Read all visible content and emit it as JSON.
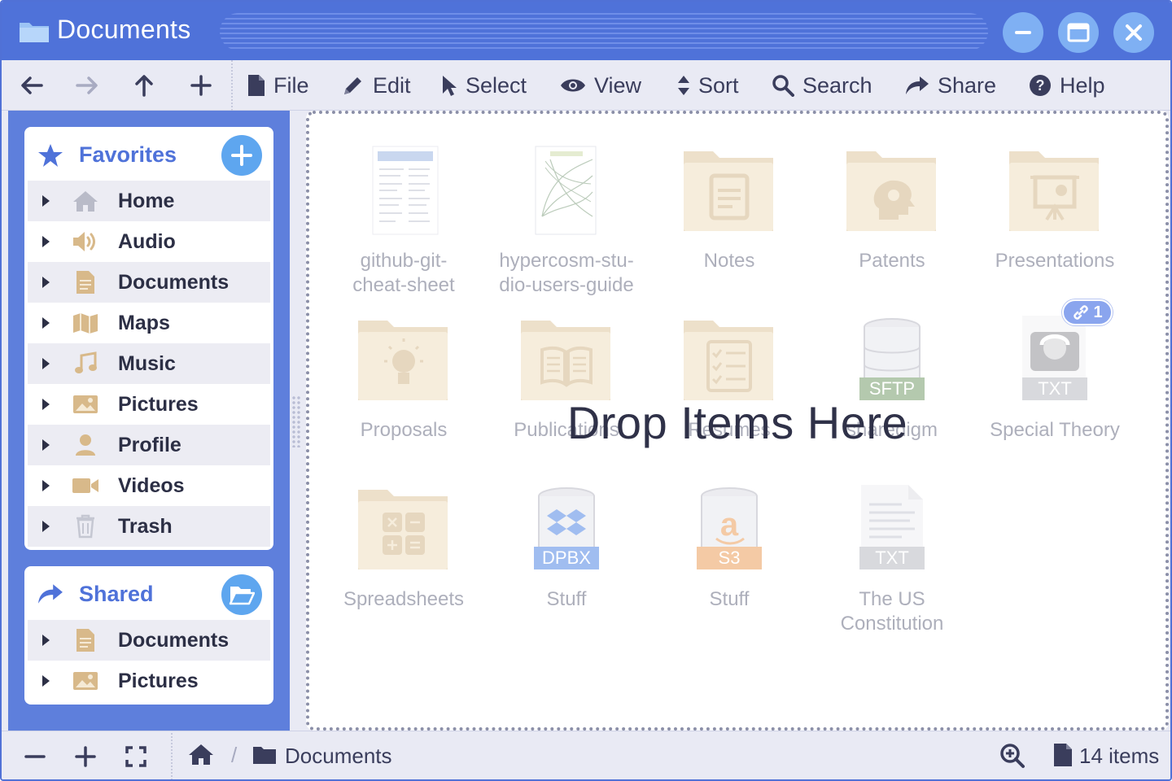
{
  "window": {
    "title": "Documents",
    "buttons": [
      "minimize",
      "maximize",
      "close"
    ],
    "accent_color": "#4f72d9"
  },
  "toolbar": {
    "nav": [
      "back",
      "forward",
      "up",
      "new"
    ],
    "menu": [
      {
        "label": "File",
        "icon": "file-icon"
      },
      {
        "label": "Edit",
        "icon": "pencil-icon"
      },
      {
        "label": "Select",
        "icon": "cursor-icon"
      },
      {
        "label": "View",
        "icon": "eye-icon"
      },
      {
        "label": "Sort",
        "icon": "sort-icon"
      },
      {
        "label": "Search",
        "icon": "search-icon"
      },
      {
        "label": "Share",
        "icon": "share-icon"
      },
      {
        "label": "Help",
        "icon": "help-icon"
      }
    ]
  },
  "sidebar": {
    "favorites": {
      "title": "Favorites",
      "items": [
        {
          "label": "Home",
          "icon": "home-icon"
        },
        {
          "label": "Audio",
          "icon": "speaker-icon"
        },
        {
          "label": "Documents",
          "icon": "document-icon"
        },
        {
          "label": "Maps",
          "icon": "map-icon"
        },
        {
          "label": "Music",
          "icon": "music-icon"
        },
        {
          "label": "Pictures",
          "icon": "picture-icon"
        },
        {
          "label": "Profile",
          "icon": "user-icon"
        },
        {
          "label": "Videos",
          "icon": "video-icon"
        },
        {
          "label": "Trash",
          "icon": "trash-icon"
        }
      ]
    },
    "shared": {
      "title": "Shared",
      "items": [
        {
          "label": "Documents",
          "icon": "document-icon"
        },
        {
          "label": "Pictures",
          "icon": "picture-icon"
        }
      ]
    }
  },
  "main": {
    "overlay_text": "Drop Items Here",
    "items": [
      {
        "name": "github-git-\ncheat-sheet",
        "kind": "pdf-thumbnail"
      },
      {
        "name": "hypercosm-stu-\ndio-users-guide",
        "kind": "book-thumbnail"
      },
      {
        "name": "Notes",
        "kind": "folder",
        "glyph": "notepad"
      },
      {
        "name": "Patents",
        "kind": "folder",
        "glyph": "head-gear"
      },
      {
        "name": "Presentations",
        "kind": "folder",
        "glyph": "easel"
      },
      {
        "name": "Proposals",
        "kind": "folder",
        "glyph": "lightbulb"
      },
      {
        "name": "Publications",
        "kind": "folder",
        "glyph": "book"
      },
      {
        "name": "Resumes",
        "kind": "folder",
        "glyph": "checklist"
      },
      {
        "name": "sharedigm",
        "kind": "server",
        "tag": "SFTP",
        "tag_color": "#5a8a4e"
      },
      {
        "name": "Special Theory",
        "kind": "text-image",
        "tag": "TXT",
        "link_count": "1"
      },
      {
        "name": "Spreadsheets",
        "kind": "folder",
        "glyph": "calculator"
      },
      {
        "name": "Stuff",
        "kind": "server",
        "tag": "DPBX",
        "tag_color": "#2f6ee0"
      },
      {
        "name": "Stuff",
        "kind": "server",
        "tag": "S3",
        "tag_color": "#e88b3a"
      },
      {
        "name": "The US\nConstitution",
        "kind": "text-file",
        "tag": "TXT"
      }
    ]
  },
  "statusbar": {
    "path": [
      "home",
      "Documents"
    ],
    "item_count": "14 items"
  }
}
